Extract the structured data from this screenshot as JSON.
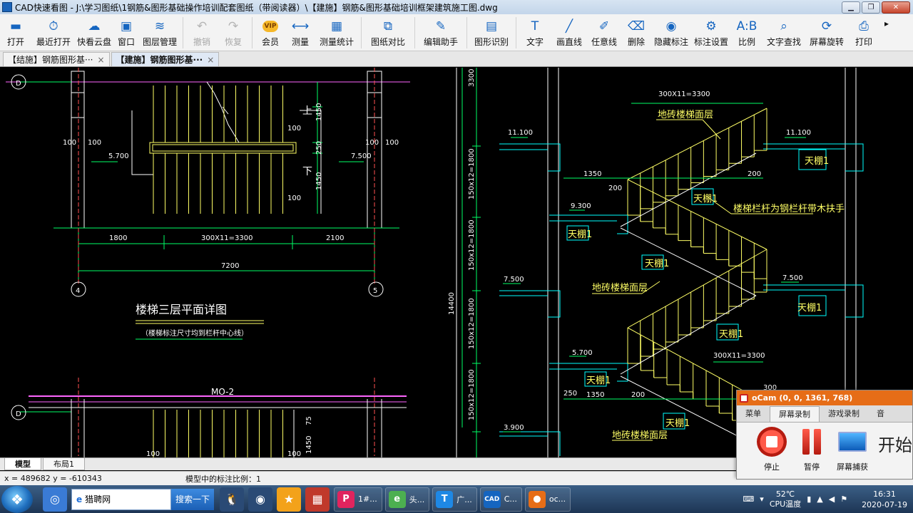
{
  "window": {
    "title": "CAD快速看图 - J:\\学习图纸\\1钢筋&图形基础操作培训配套图纸（带阅读器）\\【建施】钢筋&图形基础培训框架建筑施工图.dwg",
    "minimize": "▁",
    "maximize": "❐",
    "close": "✕"
  },
  "toolbar": {
    "items": [
      {
        "label": "打开",
        "icon": "▬"
      },
      {
        "label": "最近打开",
        "icon": "⏱"
      },
      {
        "label": "快看云盘",
        "icon": "☁"
      },
      {
        "label": "窗口",
        "icon": "▣"
      },
      {
        "label": "图层管理",
        "icon": "≋"
      },
      {
        "label": "撤销",
        "icon": "↶"
      },
      {
        "label": "恢复",
        "icon": "↷"
      },
      {
        "label": "会员",
        "icon": "VIP"
      },
      {
        "label": "测量",
        "icon": "⟷"
      },
      {
        "label": "测量统计",
        "icon": "▦"
      },
      {
        "label": "图纸对比",
        "icon": "⧉"
      },
      {
        "label": "编辑助手",
        "icon": "✎"
      },
      {
        "label": "图形识别",
        "icon": "▤"
      },
      {
        "label": "文字",
        "icon": "T"
      },
      {
        "label": "画直线",
        "icon": "╱"
      },
      {
        "label": "任意线",
        "icon": "✐"
      },
      {
        "label": "删除",
        "icon": "⌫"
      },
      {
        "label": "隐藏标注",
        "icon": "◉"
      },
      {
        "label": "标注设置",
        "icon": "⚙"
      },
      {
        "label": "比例",
        "icon": "A:B"
      },
      {
        "label": "文字查找",
        "icon": "⌕"
      },
      {
        "label": "屏幕旋转",
        "icon": "⟳"
      },
      {
        "label": "打印",
        "icon": "⎙"
      }
    ],
    "overflow": "▸"
  },
  "tabs": [
    {
      "label": "【结施】钢筋图形基···",
      "close": "×"
    },
    {
      "label": "【建施】钢筋图形基···",
      "close": "×"
    }
  ],
  "drawing": {
    "axis_d": "D",
    "axis_4": "4",
    "axis_5": "5",
    "dims": {
      "d100a": "100",
      "d100b": "100",
      "d100c": "100",
      "d100d": "100",
      "d1450a": "1450",
      "d1450b": "1450",
      "d250": "250",
      "d1800": "1800",
      "d3300": "300X11=3300",
      "d2100": "2100",
      "d7200": "7200",
      "e5700": "5.700",
      "e7500": "7.500",
      "d175": "75",
      "d1450c": "1450",
      "d100e": "100",
      "d100f": "100"
    },
    "plan_title": "楼梯三层平面详图",
    "plan_note": "（楼梯标注尺寸均到栏杆中心线）",
    "mo2": "MO-2",
    "sec": {
      "s3300": "300X11=3300",
      "s3300b": "300X11=3300",
      "dmcm1": "地砖楼梯面层",
      "dmcm2": "地砖楼梯面层",
      "dmcm3": "地砖楼梯面层",
      "railnote": "楼梯栏杆为钢栏杆带木扶手",
      "tp": "天棚1",
      "e11100a": "11.100",
      "e11100b": "11.100",
      "e9300": "9.300",
      "e7500a": "7.500",
      "e7500b": "7.500",
      "e5700": "5.700",
      "e3900": "3.900",
      "d1350a": "1350",
      "d1350b": "1350",
      "d200a": "200",
      "d200b": "200",
      "d200c": "200",
      "d250": "250",
      "d300": "300",
      "dh14400": "14400",
      "dh3300": "3300",
      "v1": "150x12=1800",
      "v2": "150x12=1800",
      "v3": "150x12=1800",
      "v4": "150x12=1800"
    }
  },
  "model_tabs": [
    "模型",
    "布局1"
  ],
  "status": {
    "coords": "x = 489682  y = -610343",
    "scale": "模型中的标注比例：1"
  },
  "ocam": {
    "title": "oCam (0, 0, 1361, 768)",
    "menu": [
      "菜单",
      "屏幕录制",
      "游戏录制",
      "音"
    ],
    "stop": "停止",
    "pause": "暂停",
    "capture": "屏幕捕获",
    "start": "开始"
  },
  "taskbar": {
    "browser_text": "猎聘网",
    "search_btn": "搜索一下",
    "items": [
      {
        "label": "1#...",
        "color": "#e0245e"
      },
      {
        "label": "头...",
        "color": "#4caf50"
      },
      {
        "label": "广...",
        "color": "#1e88e5"
      },
      {
        "label": "C...",
        "color": "#1565c0"
      },
      {
        "label": "oc...",
        "color": "#e66d17"
      }
    ],
    "temp": "52℃",
    "temp_label": "CPU温度",
    "time": "16:31",
    "date": "2020-07-19"
  },
  "colors": {
    "accent": "#1565c0",
    "cad_bg": "#000000",
    "ocam_brand": "#e66d17"
  }
}
